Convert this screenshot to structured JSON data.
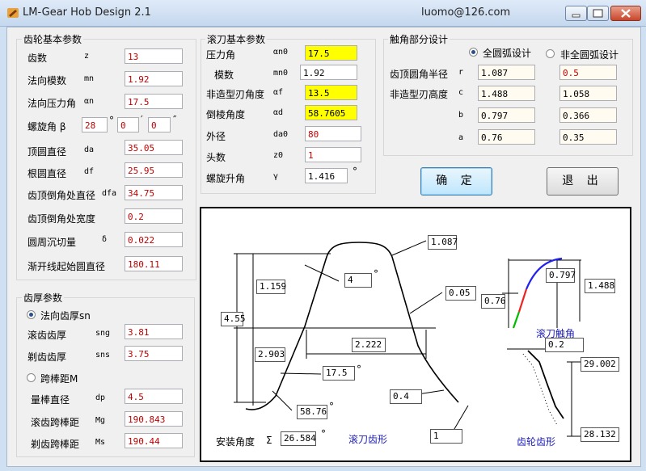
{
  "window": {
    "title": "LM-Gear Hob Design 2.1",
    "email": "luomo@126.com"
  },
  "gear": {
    "title": "齿轮基本参数",
    "teeth": {
      "label": "齿数",
      "sym": "z",
      "value": "13"
    },
    "module": {
      "label": "法向模数",
      "sym": "mn",
      "value": "1.92"
    },
    "pressure": {
      "label": "法向压力角",
      "sym": "αn",
      "value": "17.5"
    },
    "helix": {
      "label": "螺旋角 β",
      "deg": "28",
      "min": "0",
      "sec": "0",
      "deg_mark": "°",
      "min_mark": "′",
      "sec_mark": "″"
    },
    "tip_dia": {
      "label": "顶圆直径",
      "sym": "da",
      "value": "35.05"
    },
    "root_dia": {
      "label": "根圆直径",
      "sym": "df",
      "value": "25.95"
    },
    "chamfer_dia": {
      "label": "齿顶倒角处直径",
      "sym": "dfa",
      "value": "34.75"
    },
    "chamfer_width": {
      "label": "齿顶倒角处宽度",
      "value": "0.2"
    },
    "undercut": {
      "label": "圆周沉切量",
      "sym": "δ",
      "value": "0.022"
    },
    "involute_start": {
      "label": "渐开线起始圆直径",
      "value": "180.11"
    }
  },
  "thickness": {
    "title": "齿厚参数",
    "normal_opt": {
      "label": "法向齿厚sn",
      "selected": true
    },
    "rolling": {
      "label": "滚齿齿厚",
      "sym": "sng",
      "value": "3.81"
    },
    "shaving": {
      "label": "剃齿齿厚",
      "sym": "sns",
      "value": "3.75"
    },
    "span_opt": {
      "label": "跨棒距M",
      "selected": false
    },
    "pin_dia": {
      "label": "量棒直径",
      "sym": "dp",
      "value": "4.5"
    },
    "rolling_span": {
      "label": "滚齿跨棒距",
      "sym": "Mg",
      "value": "190.843"
    },
    "shaving_span": {
      "label": "剃齿跨棒距",
      "sym": "Ms",
      "value": "190.44"
    }
  },
  "hob": {
    "title": "滚刀基本参数",
    "pressure": {
      "label": "压力角",
      "sym": "αn0",
      "value": "17.5"
    },
    "module": {
      "label": "模数",
      "sym": "mn0",
      "value": "1.92"
    },
    "nonform": {
      "label": "非造型刃角度",
      "sym": "αf",
      "value": "13.5"
    },
    "chamfer": {
      "label": "倒棱角度",
      "sym": "αd",
      "value": "58.7605"
    },
    "outer": {
      "label": "外径",
      "sym": "da0",
      "value": "80"
    },
    "starts": {
      "label": "头数",
      "sym": "z0",
      "value": "1"
    },
    "lead": {
      "label": "螺旋升角",
      "sym": "γ",
      "value": "1.416",
      "unit": "°"
    }
  },
  "tip": {
    "title": "触角部分设计",
    "full_opt": {
      "label": "全圆弧设计",
      "selected": true
    },
    "nonfull_opt": {
      "label": "非全圆弧设计",
      "selected": false
    },
    "radius": {
      "label": "齿顶圆角半径",
      "sym": "r",
      "v1": "1.087",
      "v2": "0.5"
    },
    "height": {
      "label": "非造型刃高度",
      "sym": "c",
      "v1": "1.488",
      "v2": "1.058"
    },
    "b": {
      "sym": "b",
      "v1": "0.797",
      "v2": "0.366"
    },
    "a": {
      "sym": "a",
      "v1": "0.76",
      "v2": "0.35"
    }
  },
  "buttons": {
    "ok": "确 定",
    "exit": "退 出"
  },
  "figure": {
    "dims": {
      "d1087": "1.087",
      "d4": "4",
      "d1159": "1.159",
      "d455": "4.55",
      "d005": "0.05",
      "d2222": "2.222",
      "d2903": "2.903",
      "d175": "17.5",
      "d04": "0.4",
      "d5876": "58.76",
      "d1": "1",
      "t0797": "0.797",
      "t1488": "1.488",
      "t076": "0.76",
      "g02": "0.2",
      "g29002": "29.002",
      "g28132": "28.132"
    },
    "deg": "°",
    "hob_profile": "滚刀齿形",
    "hob_tip": "滚刀触角",
    "gear_profile": "齿轮齿形",
    "install": {
      "label": "安装角度",
      "sym": "Σ",
      "value": "26.584",
      "unit": "°"
    }
  }
}
